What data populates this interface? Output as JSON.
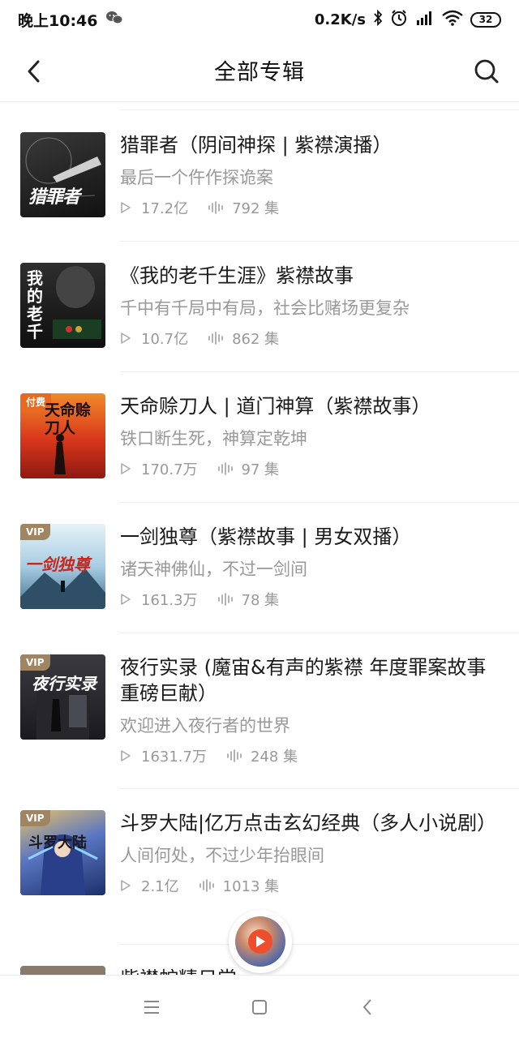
{
  "status": {
    "time": "晚上10:46",
    "speed": "0.2K/s",
    "battery": "32"
  },
  "header": {
    "title": "全部专辑"
  },
  "items": [
    {
      "title": "猎罪者（阴间神探 | 紫襟演播）",
      "desc": "最后一个仵作探诡案",
      "plays": "17.2亿",
      "episodes": "792 集",
      "badge": "",
      "cover_text": "猎罪者",
      "cover_color": "#2b2b2b"
    },
    {
      "title": "《我的老千生涯》紫襟故事",
      "desc": "千中有千局中有局，社会比赌场更复杂",
      "plays": "10.7亿",
      "episodes": "862 集",
      "badge": "",
      "cover_text": "我的老千",
      "cover_color": "#1d1d1d"
    },
    {
      "title": "天命赊刀人 | 道门神算（紫襟故事）",
      "desc": "铁口断生死，神算定乾坤",
      "plays": "170.7万",
      "episodes": "97 集",
      "badge": "付费",
      "cover_text": "天命赊刀人",
      "cover_color": "#d9431c"
    },
    {
      "title": "一剑独尊（紫襟故事 | 男女双播）",
      "desc": "诸天神佛仙，不过一剑间",
      "plays": "161.3万",
      "episodes": "78 集",
      "badge": "VIP",
      "cover_text": "一剑独尊",
      "cover_color": "#b9d7ea"
    },
    {
      "title": "夜行实录 (魔宙&有声的紫襟 年度罪案故事重磅巨献）",
      "desc": "欢迎进入夜行者的世界",
      "plays": "1631.7万",
      "episodes": "248 集",
      "badge": "VIP",
      "cover_text": "夜行实录",
      "cover_color": "#2a2a2e"
    },
    {
      "title": "斗罗大陆|亿万点击玄幻经典（多人小说剧）",
      "desc": "人间何处，不过少年抬眼间",
      "plays": "2.1亿",
      "episodes": "1013 集",
      "badge": "VIP",
      "cover_text": "斗罗大陆",
      "cover_color": "#3b5aa8"
    },
    {
      "title": "紫襟蛇精日常",
      "desc": "",
      "plays": "",
      "episodes": "",
      "badge": "",
      "cover_text": "",
      "cover_color": "#8a7a6a"
    }
  ]
}
